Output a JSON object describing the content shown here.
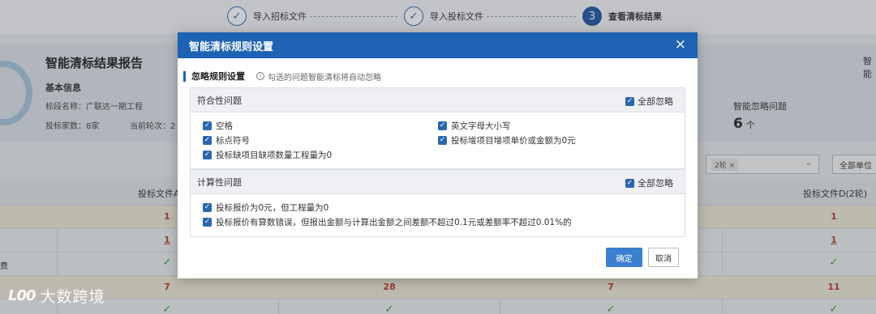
{
  "steps": [
    {
      "index": "✓",
      "label": "导入招标文件",
      "state": "done"
    },
    {
      "index": "✓",
      "label": "导入投标文件",
      "state": "done"
    },
    {
      "index": "3",
      "label": "查看清标结果",
      "state": "active"
    }
  ],
  "report": {
    "title": "智能清标结果报告",
    "basic_info": "基本信息",
    "section_name": "标段名称：广联达一期工程",
    "bidders_round": "投标家数：8家",
    "current_round": "当前轮次：2",
    "right_title": "智能",
    "smart_ignore_label": "智能忽略问题",
    "smart_ignore_count": "6",
    "smart_ignore_unit": "个"
  },
  "filters": {
    "round_tag": "2轮",
    "round_tag_close": "×",
    "all_units": "全部单位"
  },
  "table": {
    "headers": [
      "投标文件A",
      "投标文件D(2轮)"
    ],
    "rows": [
      {
        "label": "",
        "col_a": "1",
        "col_b": "",
        "col_c": "",
        "col_d": "1",
        "style": "alt"
      },
      {
        "label": "",
        "col_a": "1",
        "col_b": "",
        "col_c": "",
        "col_d": "1",
        "style": "underline"
      },
      {
        "label": "费",
        "col_a": "✓",
        "col_b": "",
        "col_c": "",
        "col_d": "✓",
        "style": "ok"
      },
      {
        "label": "",
        "col_a": "7",
        "col_b": "28",
        "col_c": "7",
        "col_d": "11",
        "style": "alt"
      },
      {
        "label": "",
        "col_a": "✓",
        "col_b": "✓",
        "col_c": "✓",
        "col_d": "✓",
        "style": "ok"
      }
    ]
  },
  "watermark": {
    "logo": "L00",
    "text": "大数跨境"
  },
  "modal": {
    "title": "智能清标规则设置",
    "close": "×",
    "section_title": "忽略规则设置",
    "hint": "勾选的问题智能清标将自动忽略",
    "groups": [
      {
        "title": "符合性问题",
        "select_all": "全部忽略",
        "options": [
          {
            "label": "空格",
            "checked": true
          },
          {
            "label": "英文字母大小写",
            "checked": true
          },
          {
            "label": "标点符号",
            "checked": true
          },
          {
            "label": "投标增项目增项单价或金额为0元",
            "checked": true
          },
          {
            "label": "投标缺项目缺项数量工程量为0",
            "checked": true
          }
        ]
      },
      {
        "title": "计算性问题",
        "select_all": "全部忽略",
        "options": [
          {
            "label": "投标报价为0元，但工程量为0",
            "checked": true
          },
          {
            "label": "投标报价有算数错误，但报出金额与计算出金额之间差额不超过0.1元或差额率不超过0.01%的",
            "checked": true
          }
        ]
      }
    ],
    "confirm": "确定",
    "cancel": "取消"
  },
  "colors": {
    "primary": "#1d62b3",
    "checkbox": "#2a66ae",
    "error_value": "#c0392b",
    "ok_value": "#2e9a3e"
  }
}
